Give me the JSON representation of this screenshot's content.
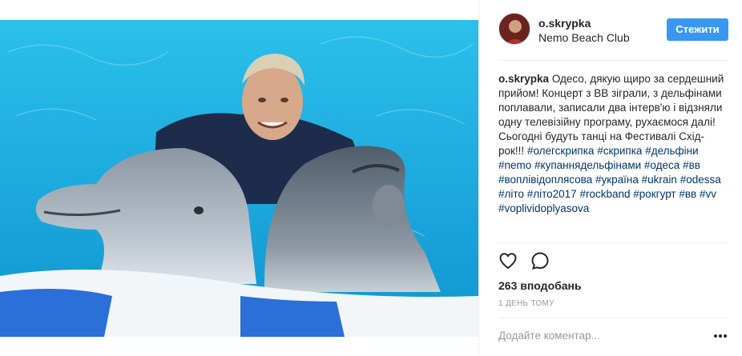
{
  "post": {
    "username": "o.skrypka",
    "location": "Nemo Beach Club",
    "follow_label": "Стежити",
    "caption_user": "o.skrypka",
    "caption_text": "Одесо, дякую щиро за сердешний прийом! Концерт з ВВ зіграли, з дельфінами поплавали, записали два інтерв'ю і відзняли одну телевізійну програму, рухаємося далі! Сьогодні будуть танці на Фестивалі Схід-рок!!!",
    "hashtags": [
      "#олегскрипка",
      "#скрипка",
      "#дельфіни",
      "#nemo",
      "#купаннядельфінами",
      "#одеса",
      "#вв",
      "#воплівідоплясова",
      "#україна",
      "#ukrain",
      "#odessa",
      "#літо",
      "#літо2017",
      "#rockband",
      "#рокгурт",
      "#вв",
      "#vv",
      "#voplividoplyasova"
    ],
    "likes": "263 вподобань",
    "timestamp": "1 ДЕНЬ ТОМУ",
    "comment_placeholder": "Додайте коментар..."
  },
  "icons": {
    "like": "heart-icon",
    "comment": "comment-icon",
    "more": "more-dots-icon"
  },
  "colors": {
    "follow_button": "#3897f0",
    "hashtag": "#003569",
    "water": "#1aaee3"
  }
}
